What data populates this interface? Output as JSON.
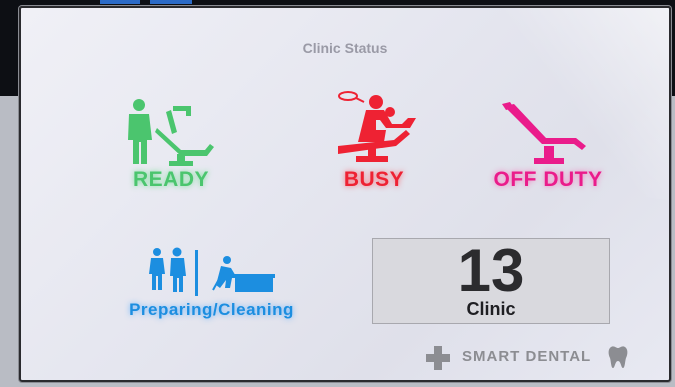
{
  "page": {
    "title": "Clinic Status"
  },
  "statuses": {
    "ready": {
      "label": "READY",
      "color": "#4bc56e",
      "icon": "doctor-with-dental-chair-icon"
    },
    "busy": {
      "label": "BUSY",
      "color": "#ee2233",
      "icon": "dentist-treating-patient-icon"
    },
    "off_duty": {
      "label": "OFF DUTY",
      "color": "#ea1c8b",
      "icon": "empty-dental-chair-icon"
    },
    "preparing": {
      "label": "Preparing/Cleaning",
      "color": "#1c8ee0",
      "icon": "staff-cleaning-icon"
    }
  },
  "clinic": {
    "number": "13",
    "label": "Clinic"
  },
  "brand": {
    "text": "SMART DENTAL",
    "cross_icon": "plus-cross-icon",
    "tooth_icon": "tooth-icon",
    "color": "#8c8d92"
  }
}
